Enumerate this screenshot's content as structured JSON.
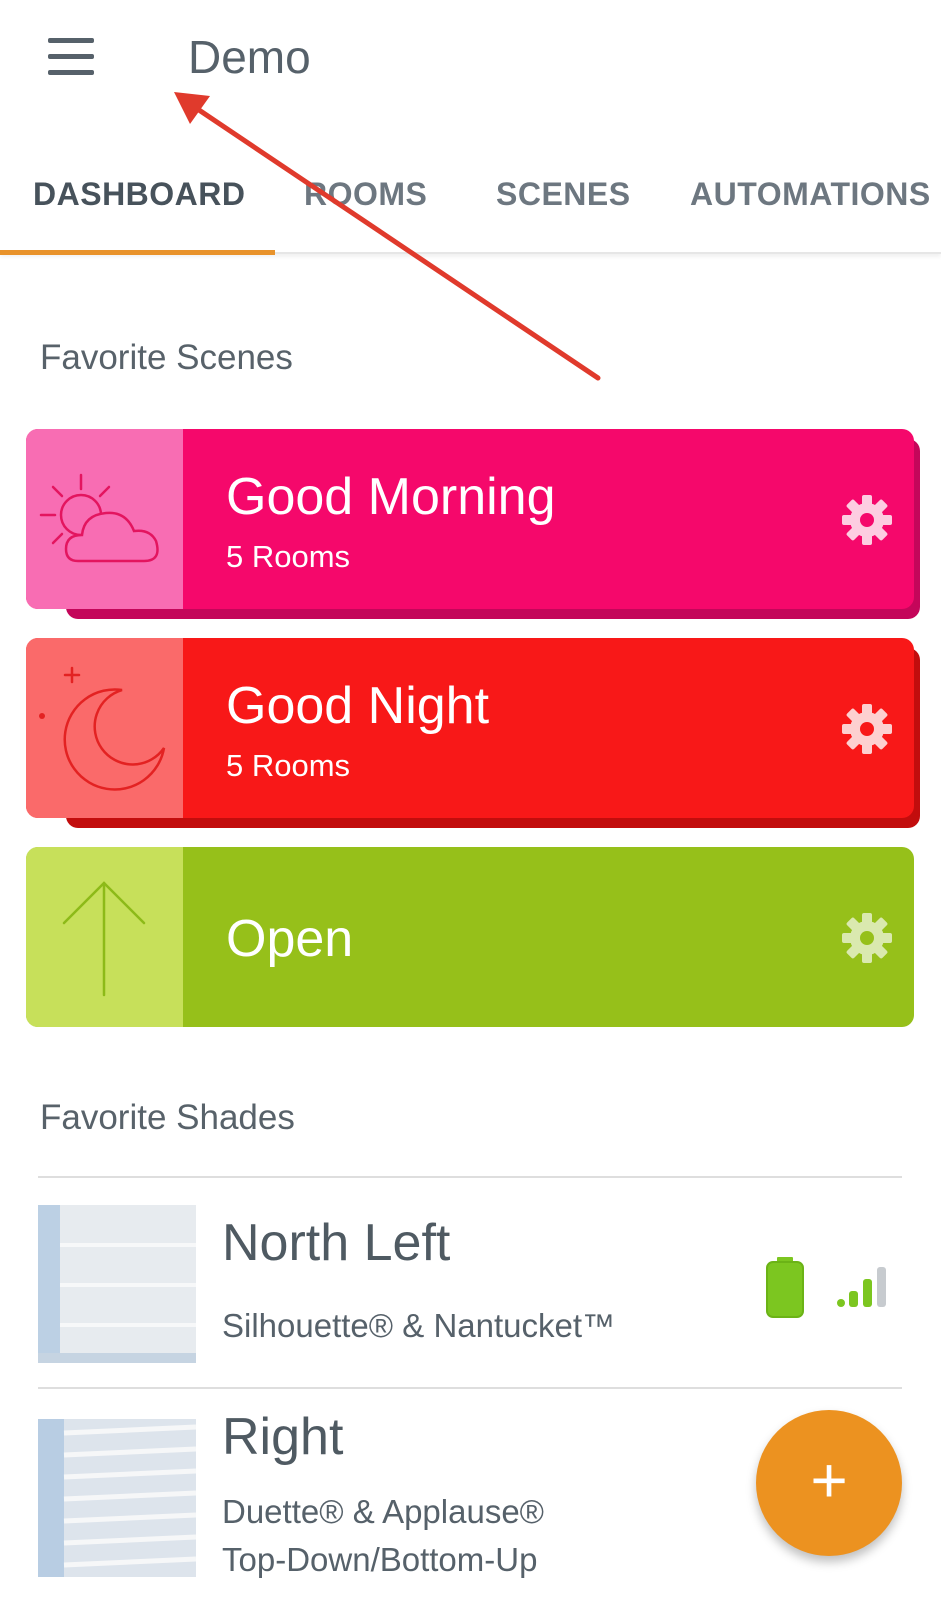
{
  "appbar": {
    "title": "Demo"
  },
  "tabs": [
    {
      "label": "DASHBOARD",
      "active": true
    },
    {
      "label": "ROOMS",
      "active": false
    },
    {
      "label": "SCENES",
      "active": false
    },
    {
      "label": "AUTOMATIONS",
      "active": false
    }
  ],
  "favorite_scenes": {
    "heading": "Favorite Scenes",
    "items": [
      {
        "name": "Good Morning",
        "sub": "5 Rooms",
        "icon": "sun-cloud-icon",
        "color": "#f5086b",
        "panel_color": "#f86db3"
      },
      {
        "name": "Good Night",
        "sub": "5 Rooms",
        "icon": "moon-icon",
        "color": "#f81818",
        "panel_color": "#fa6a6a"
      },
      {
        "name": "Open",
        "sub": "",
        "icon": "arrow-up-icon",
        "color": "#96c01a",
        "panel_color": "#c7e05a"
      }
    ]
  },
  "favorite_shades": {
    "heading": "Favorite Shades",
    "items": [
      {
        "name": "North Left",
        "desc_line1": "Silhouette® & Nantucket™",
        "desc_line2": "",
        "battery": "full",
        "signal": "3/4"
      },
      {
        "name": "Right",
        "desc_line1": "Duette® & Applause®",
        "desc_line2": "Top-Down/Bottom-Up"
      }
    ]
  },
  "fab": {
    "label": "+",
    "icon": "plus-icon",
    "color": "#ec9220"
  },
  "annotation": {
    "icon": "red-arrow-annotation",
    "color": "#e03a2c"
  }
}
